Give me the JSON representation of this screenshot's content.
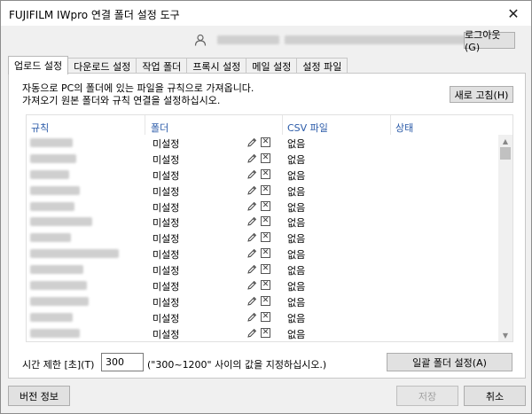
{
  "window": {
    "title": "FUJIFILM IWpro 연결 폴더 설정 도구",
    "close_glyph": "✕"
  },
  "header": {
    "logout_label": "로그아웃(G)"
  },
  "tabs": [
    {
      "label": "업로드 설정",
      "active": true
    },
    {
      "label": "다운로드 설정",
      "active": false
    },
    {
      "label": "작업 폴더",
      "active": false
    },
    {
      "label": "프록시 설정",
      "active": false
    },
    {
      "label": "메일 설정",
      "active": false
    },
    {
      "label": "설정 파일",
      "active": false
    }
  ],
  "upload": {
    "description_line1": "자동으로 PC의 폴더에 있는 파일을 규칙으로 가져옵니다.",
    "description_line2": "가져오기 원본 폴더와 규칙 연결을 설정하십시오.",
    "refresh_label": "새로 고침(H)",
    "columns": {
      "rule": "규칙",
      "folder": "폴더",
      "csv": "CSV 파일",
      "status": "상태"
    },
    "rows": [
      {
        "folder": "미설정",
        "csv": "없음"
      },
      {
        "folder": "미설정",
        "csv": "없음"
      },
      {
        "folder": "미설정",
        "csv": "없음"
      },
      {
        "folder": "미설정",
        "csv": "없음"
      },
      {
        "folder": "미설정",
        "csv": "없음"
      },
      {
        "folder": "미설정",
        "csv": "없음"
      },
      {
        "folder": "미설정",
        "csv": "없음"
      },
      {
        "folder": "미설정",
        "csv": "없음"
      },
      {
        "folder": "미설정",
        "csv": "없음"
      },
      {
        "folder": "미설정",
        "csv": "없음"
      },
      {
        "folder": "미설정",
        "csv": "없음"
      },
      {
        "folder": "미설정",
        "csv": "없음"
      },
      {
        "folder": "미설정",
        "csv": "없음"
      }
    ],
    "time_limit_label": "시간 제한 [초](T)",
    "time_limit_value": "300",
    "time_limit_hint": "(\"300~1200\" 사이의 값을 지정하십시오.)",
    "bulk_folder_label": "일괄 폴더 설정(A)"
  },
  "footer": {
    "version_label": "버전 정보",
    "save_label": "저장",
    "cancel_label": "취소"
  }
}
